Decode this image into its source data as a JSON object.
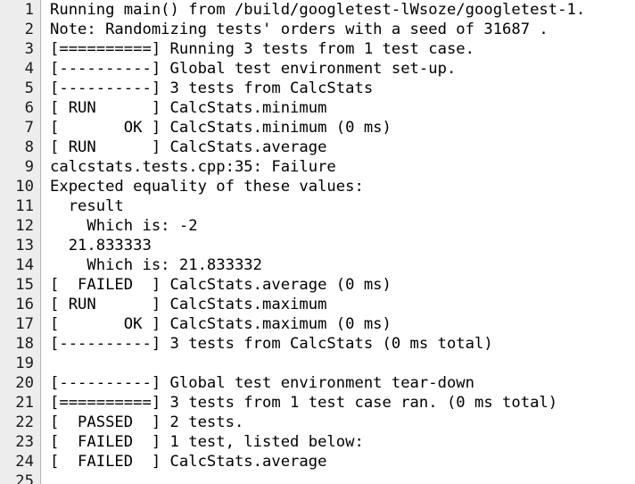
{
  "editor": {
    "lines": [
      {
        "number": "1",
        "text": "Running main() from /build/googletest-lWsoze/googletest-1."
      },
      {
        "number": "2",
        "text": "Note: Randomizing tests' orders with a seed of 31687 ."
      },
      {
        "number": "3",
        "text": "[==========] Running 3 tests from 1 test case."
      },
      {
        "number": "4",
        "text": "[----------] Global test environment set-up."
      },
      {
        "number": "5",
        "text": "[----------] 3 tests from CalcStats"
      },
      {
        "number": "6",
        "text": "[ RUN      ] CalcStats.minimum"
      },
      {
        "number": "7",
        "text": "[       OK ] CalcStats.minimum (0 ms)"
      },
      {
        "number": "8",
        "text": "[ RUN      ] CalcStats.average"
      },
      {
        "number": "9",
        "text": "calcstats.tests.cpp:35: Failure"
      },
      {
        "number": "10",
        "text": "Expected equality of these values:"
      },
      {
        "number": "11",
        "text": "  result"
      },
      {
        "number": "12",
        "text": "    Which is: -2"
      },
      {
        "number": "13",
        "text": "  21.833333"
      },
      {
        "number": "14",
        "text": "    Which is: 21.833332"
      },
      {
        "number": "15",
        "text": "[  FAILED  ] CalcStats.average (0 ms)"
      },
      {
        "number": "16",
        "text": "[ RUN      ] CalcStats.maximum"
      },
      {
        "number": "17",
        "text": "[       OK ] CalcStats.maximum (0 ms)"
      },
      {
        "number": "18",
        "text": "[----------] 3 tests from CalcStats (0 ms total)"
      },
      {
        "number": "19",
        "text": ""
      },
      {
        "number": "20",
        "text": "[----------] Global test environment tear-down"
      },
      {
        "number": "21",
        "text": "[==========] 3 tests from 1 test case ran. (0 ms total)"
      },
      {
        "number": "22",
        "text": "[  PASSED  ] 2 tests."
      },
      {
        "number": "23",
        "text": "[  FAILED  ] 1 test, listed below:"
      },
      {
        "number": "24",
        "text": "[  FAILED  ] CalcStats.average"
      },
      {
        "number": "25",
        "text": ""
      }
    ]
  }
}
